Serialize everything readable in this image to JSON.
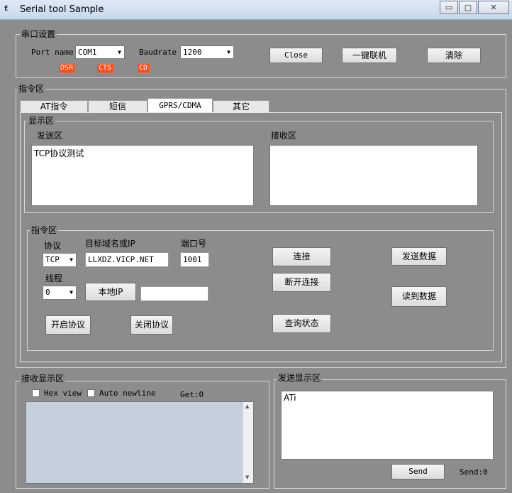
{
  "window": {
    "title": "Serial tool Sample",
    "icon_text": "ƭ",
    "minimize": "▭",
    "restore": "▢",
    "close": "✕"
  },
  "serial": {
    "group_label": "串口设置",
    "port_label": "Port name",
    "port_value": "COM1",
    "baud_label": "Baudrate",
    "baud_value": "1200",
    "status": [
      "DSR",
      "CTS",
      "CD"
    ],
    "close_btn": "Close",
    "connect_btn": "一键联机",
    "clear_btn": "清除"
  },
  "command": {
    "group_label": "指令区",
    "tabs": [
      "AT指令",
      "短信",
      "GPRS/CDMA",
      "其它"
    ],
    "display_label": "显示区",
    "send_area_label": "发送区",
    "send_area_text": "TCP协议测试",
    "recv_area_label": "接收区",
    "recv_area_text": "",
    "inner_label": "指令区",
    "protocol_label": "协议",
    "protocol_value": "TCP",
    "host_label": "目标域名或IP",
    "host_value": "LLXDZ.VICP.NET",
    "port_label": "端口号",
    "port_value": "1001",
    "thread_label": "线程",
    "thread_value": "0",
    "local_ip_btn": "本地IP",
    "local_ip_value": "",
    "connect_btn": "连接",
    "disconnect_btn": "断开连接",
    "query_btn": "查询状态",
    "send_data_btn": "发送数据",
    "read_data_btn": "读到数据",
    "open_proto_btn": "开启协议",
    "close_proto_btn": "关闭协议"
  },
  "receive": {
    "group_label": "接收显示区",
    "hex_label": "Hex view",
    "newline_label": "Auto newline",
    "get_count": "Get:0",
    "text": ""
  },
  "send": {
    "group_label": "发送显示区",
    "text": "ATi",
    "send_btn": "Send",
    "send_count": "Send:0"
  }
}
